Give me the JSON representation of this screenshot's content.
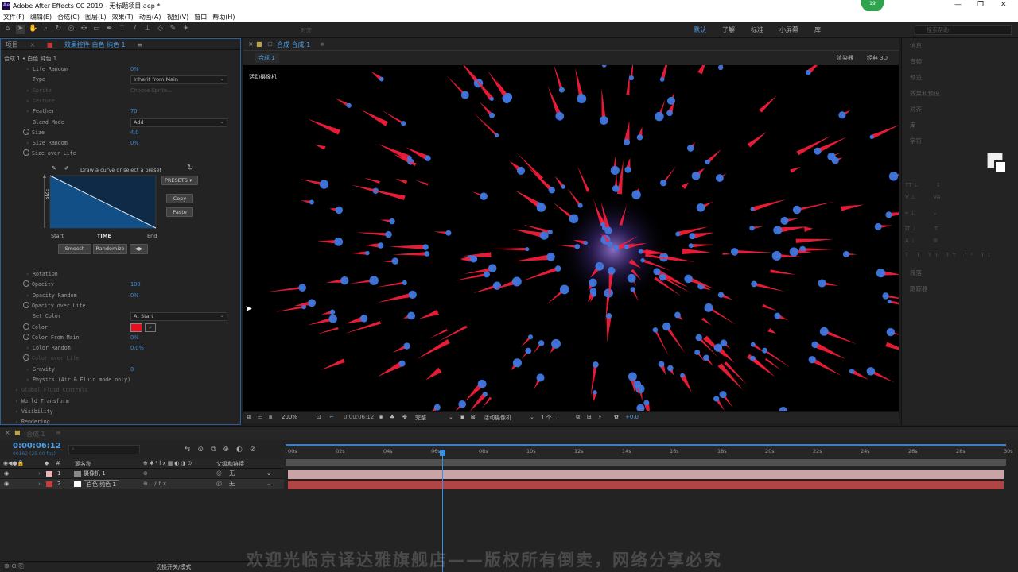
{
  "app": {
    "title": "Adobe After Effects CC 2019 - 无标题项目.aep *",
    "badge": "19"
  },
  "menu": [
    "文件(F)",
    "编辑(E)",
    "合成(C)",
    "图层(L)",
    "效果(T)",
    "动画(A)",
    "视图(V)",
    "窗口",
    "帮助(H)"
  ],
  "toolbar": {
    "align": "对齐"
  },
  "workspaces": [
    {
      "label": "默认",
      "active": true
    },
    {
      "label": "了解"
    },
    {
      "label": "标准"
    },
    {
      "label": "小屏幕"
    },
    {
      "label": "库"
    }
  ],
  "search_help": "搜索帮助",
  "left_panel": {
    "tabs": [
      "项目",
      "效果控件 白色 纯色 1"
    ],
    "breadcrumb": "合成 1 • 白色 纯色 1",
    "props": [
      {
        "label": "Life Random",
        "value": "0%"
      },
      {
        "label": "Type",
        "dropdown": "Inherit from Main"
      },
      {
        "label": "Sprite",
        "value": "Choose Sprite...",
        "dim": true
      },
      {
        "label": "Texture",
        "dim": true
      },
      {
        "label": "Feather",
        "value": "70"
      },
      {
        "label": "Blend Mode",
        "dropdown": "Add"
      },
      {
        "label": "Size",
        "value": "4.0"
      },
      {
        "label": "Size Random",
        "value": "0%"
      },
      {
        "label": "Size over Life"
      }
    ],
    "curve": {
      "hint": "Draw a curve or select a preset",
      "presets": "PRESETS",
      "copy": "Copy",
      "paste": "Paste",
      "y_label": "SIZE",
      "x_start": "Start",
      "x_mid": "TIME",
      "x_end": "End",
      "smooth": "Smooth",
      "randomize": "Randomize"
    },
    "props2": [
      {
        "label": "Rotation"
      },
      {
        "label": "Opacity",
        "value": "100"
      },
      {
        "label": "Opacity Random",
        "value": "0%"
      },
      {
        "label": "Opacity over Life"
      },
      {
        "label": "Set Color",
        "dropdown": "At Start"
      },
      {
        "label": "Color",
        "color": "#e8101c"
      },
      {
        "label": "Color From Main",
        "value": "0%"
      },
      {
        "label": "Color Random",
        "value": "0.0%"
      },
      {
        "label": "Color over Life",
        "dim": true
      },
      {
        "label": "Gravity",
        "value": "0"
      },
      {
        "label": "Physics (Air & Fluid mode only)"
      },
      {
        "label": "Global Fluid Controls",
        "dim": true
      },
      {
        "label": "World Transform"
      },
      {
        "label": "Visibility"
      },
      {
        "label": "Rendering"
      }
    ]
  },
  "composition": {
    "tab": "合成 合成 1",
    "sub_tab": "合成 1",
    "renderer": "渲染器",
    "classic3d": "经典 3D",
    "camera_label": "活动摄像机"
  },
  "viewer_bar": {
    "zoom": "200%",
    "timecode": "0:00:06:12",
    "quality": "完整",
    "camera": "活动摄像机",
    "views": "1 个...",
    "exposure": "+0.0"
  },
  "right_panel": [
    "信息",
    "音频",
    "预览",
    "效果和预设",
    "对齐",
    "库",
    "字符"
  ],
  "right_panel_lower": [
    "段落",
    "跟踪器"
  ],
  "timeline": {
    "tab": "合成 1",
    "timecode": "0:00:06:12",
    "fps": "00162 (25.00 fps)",
    "col_name": "源名称",
    "col_parent": "父级和链接",
    "switch_label": "切换开关/模式",
    "layers": [
      {
        "num": "1",
        "name": "摄像机 1",
        "color": "#e8b4b8",
        "parent": "无"
      },
      {
        "num": "2",
        "name": "白色 纯色 1",
        "color": "#cc3b3b",
        "parent": "无"
      }
    ],
    "ruler": [
      "00s",
      "02s",
      "04s",
      "06s",
      "08s",
      "10s",
      "12s",
      "14s",
      "16s",
      "18s",
      "20s",
      "22s",
      "24s",
      "26s",
      "28s",
      "30s"
    ],
    "playhead_fraction": 0.216
  },
  "watermark": "欢迎光临京译达雅旗舰店——版权所有倒卖，网络分享必究"
}
